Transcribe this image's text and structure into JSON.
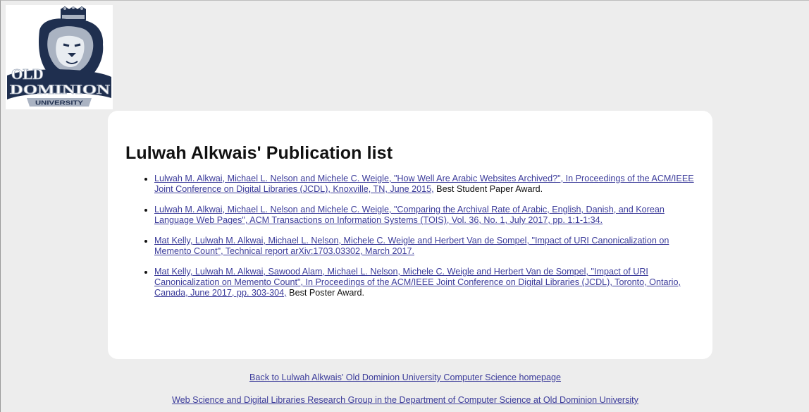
{
  "logo": {
    "name": "old-dominion-university-logo",
    "line1": "OLD",
    "line2": "DOMINION",
    "line3": "UNIVERSITY",
    "colors": {
      "navy": "#1f2f4f",
      "silver": "#aab3c2"
    }
  },
  "main": {
    "title": "Lulwah Alkwais' Publication list",
    "publications": [
      {
        "link_text": "Lulwah M. Alkwai, Michael L. Nelson and Michele C. Weigle, \"How Well Are Arabic Websites Archived?\", In Proceedings of the ACM/IEEE Joint Conference on Digital Libraries (JCDL), Knoxville, TN, June 2015,",
        "award": " Best Student Paper Award."
      },
      {
        "link_text": "Lulwah M. Alkwai, Michael L. Nelson and Michele C. Weigle, \"Comparing the Archival Rate of Arabic, English, Danish, and Korean Language Web Pages\", ACM Transactions on Information Systems (TOIS), Vol. 36, No. 1, July 2017, pp. 1:1-1:34.",
        "award": ""
      },
      {
        "link_text": "Mat Kelly, Lulwah M. Alkwai, Michael L. Nelson, Michele C. Weigle and Herbert Van de Sompel, \"Impact of URI Canonicalization on Memento Count\", Technical report arXiv:1703.03302, March 2017.",
        "award": ""
      },
      {
        "link_text": "Mat Kelly, Lulwah M. Alkwai, Sawood Alam, Michael L. Nelson, Michele C. Weigle and Herbert Van de Sompel, \"Impact of URI Canonicalization on Memento Count\", In Proceedings of the ACM/IEEE Joint Conference on Digital Libraries (JCDL), Toronto, Ontario, Canada, June 2017, pp. 303-304,",
        "award": " Best Poster Award."
      }
    ]
  },
  "footer": {
    "homepage_link": "Back to Lulwah Alkwais' Old Dominion University Computer Science homepage",
    "group_link": "Web Science and Digital Libraries Research Group in the Department of Computer Science at Old Dominion University"
  },
  "colors": {
    "background": "#ededed",
    "card": "#ffffff",
    "link": "#3b3b9a"
  }
}
